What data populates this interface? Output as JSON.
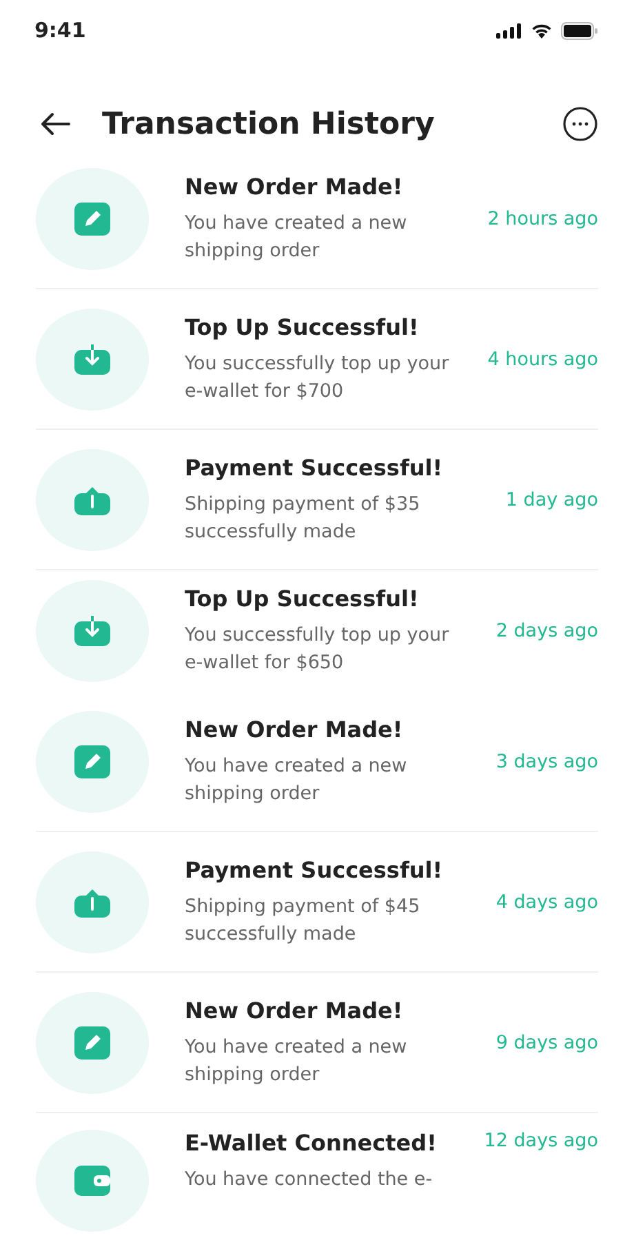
{
  "status_bar": {
    "time": "9:41"
  },
  "header": {
    "title": "Transaction History"
  },
  "transactions": [
    {
      "kind": "order",
      "title": "New Order Made!",
      "description": "You have created a new shipping order",
      "time": "2 hours ago",
      "divider": true
    },
    {
      "kind": "topup",
      "title": "Top Up Successful!",
      "description": "You successfully top up your e-wallet for $700",
      "time": "4 hours ago",
      "divider": true
    },
    {
      "kind": "payment",
      "title": "Payment Successful!",
      "description": "Shipping payment of $35 successfully made",
      "time": "1 day ago",
      "divider": true
    },
    {
      "kind": "topup",
      "title": "Top Up Successful!",
      "description": "You successfully top up your e-wallet for $650",
      "time": "2 days ago",
      "divider": false
    },
    {
      "kind": "order",
      "title": "New Order Made!",
      "description": "You have created a new shipping order",
      "time": "3 days ago",
      "divider": true
    },
    {
      "kind": "payment",
      "title": "Payment Successful!",
      "description": "Shipping payment of $45 successfully made",
      "time": "4 days ago",
      "divider": true
    },
    {
      "kind": "order",
      "title": "New Order Made!",
      "description": "You have created a new shipping order",
      "time": "9 days ago",
      "divider": true
    },
    {
      "kind": "wallet",
      "title": "E-Wallet Connected!",
      "description": "You have connected the e-",
      "time": "12 days ago",
      "divider": false
    }
  ]
}
